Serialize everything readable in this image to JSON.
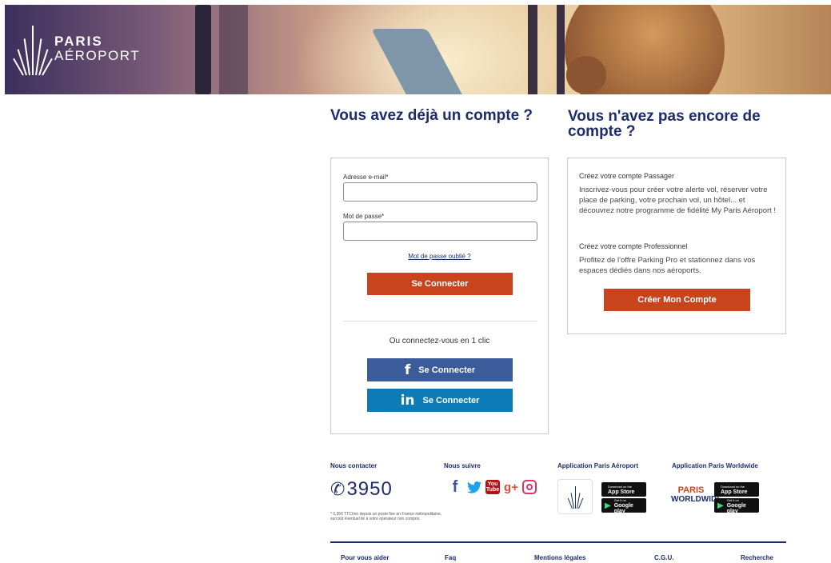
{
  "brand": {
    "line1": "PARIS",
    "line2": "AÉROPORT"
  },
  "login": {
    "heading": "Vous avez déjà un compte ?",
    "email_label": "Adresse e-mail*",
    "email_value": "",
    "password_label": "Mot de passe*",
    "password_value": "",
    "forgot_link": "Mot de passe oublié ?",
    "submit_label": "Se Connecter",
    "oneclick_text": "Ou connectez-vous en 1 clic",
    "facebook": {
      "icon": "f",
      "label": "Se Connecter"
    },
    "linkedin": {
      "icon": "in",
      "label": "Se Connecter"
    }
  },
  "signup": {
    "heading": "Vous n'avez pas encore de compte ?",
    "passenger_title": "Créez votre compte Passager",
    "passenger_text": "Inscrivez-vous pour créer votre alerte vol, réserver votre place de parking, votre prochain vol, un hôtel... et découvrez notre programme de fidélité My Paris Aéroport !",
    "pro_title": "Créez votre compte Professionnel",
    "pro_text": "Profitez de l'offre Parking Pro et stationnez dans vos espaces dédiés dans nos aéroports.",
    "button_label": "Créer Mon Compte"
  },
  "footer": {
    "contact_title": "Nous contacter",
    "phone_number": "3950",
    "phone_note": "* 0,35€ TTC/mn depuis un poste fixe en France métropolitaine, surcoût éventuel lié à votre opérateur non compris.",
    "follow_title": "Nous suivre",
    "social": {
      "facebook": "f",
      "youtube_line1": "You",
      "youtube_line2": "Tube",
      "googleplus": "g+"
    },
    "app_pa_title": "Application Paris Aéroport",
    "app_pw_title": "Application Paris Worldwide",
    "pw_logo_line1": "PARIS",
    "pw_logo_line2": "WORLDWIDE",
    "appstore_small": "Download on the",
    "appstore_big": "App Store",
    "googleplay_small": "Get it on",
    "googleplay_big": "Google play",
    "links": [
      "Pour vous aider",
      "Faq",
      "Mentions légales",
      "C.G.U.",
      "Recherche"
    ]
  },
  "colors": {
    "accent_orange": "#c9441c",
    "navy": "#1d2d6b",
    "facebook_blue": "#3b5b9a",
    "linkedin_blue": "#0d7bb5"
  }
}
